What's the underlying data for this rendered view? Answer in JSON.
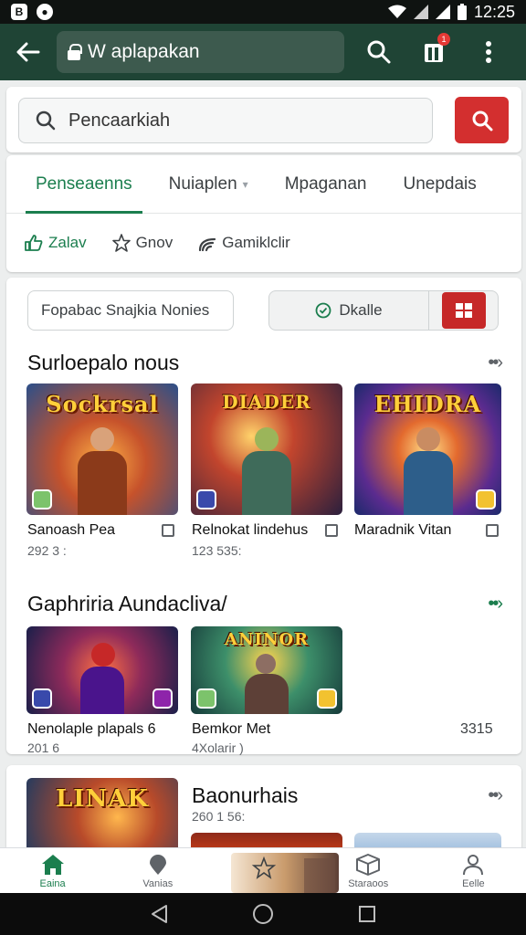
{
  "status": {
    "time": "12:25",
    "left_icon_1": "B",
    "left_icon_2": "●"
  },
  "appbar": {
    "url": "W aplapakan",
    "notification_count": "1"
  },
  "search": {
    "placeholder": "Pencaarkiah"
  },
  "tabs": [
    {
      "label": "Penseaenns"
    },
    {
      "label": "Nuiaplen"
    },
    {
      "label": "Mpaganan"
    },
    {
      "label": "Unepdais"
    }
  ],
  "chips": [
    {
      "label": "Zalav"
    },
    {
      "label": "Gnov"
    },
    {
      "label": "Gamiklclir"
    }
  ],
  "filters": {
    "input_text": "Fopabac Snajkia Nonies",
    "toggle_label": "Dkalle"
  },
  "section1": {
    "title": "Surloepalo nous",
    "items": [
      {
        "art_title": "Sockrsal",
        "name": "Sanoash Pea",
        "sub": "292 3 :"
      },
      {
        "art_title": "DIADER",
        "name": "Relnokat lindehus",
        "sub": "123 535:"
      },
      {
        "art_title": "EHIDRA",
        "name": "Maradnik Vitan",
        "sub": ""
      }
    ]
  },
  "section2": {
    "title": "Gaphriria Aundacliva/",
    "items": [
      {
        "art_title": "",
        "name": "Nenolaple plapals 6",
        "sub": "201 6"
      },
      {
        "art_title": "ANINOR",
        "name": "Bemkor Met",
        "sub": "4Xolarir )"
      }
    ],
    "side_value": "3315"
  },
  "section3": {
    "art_title": "LINAK",
    "title": "Baonurhais",
    "sub": "260 1 56:"
  },
  "bottom_nav": [
    {
      "label": "Eaina"
    },
    {
      "label": "Vanias"
    },
    {
      "label": ""
    },
    {
      "label": "Staraoos"
    },
    {
      "label": "Eelle"
    }
  ],
  "colors": {
    "appbar": "#1f4435",
    "accent_green": "#1b7e4e",
    "accent_red": "#d32f2f"
  }
}
